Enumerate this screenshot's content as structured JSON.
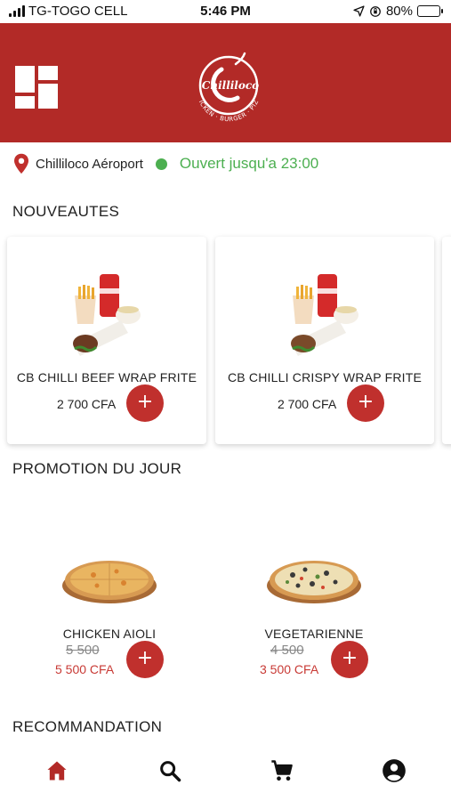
{
  "status_bar": {
    "carrier": "TG-TOGO CELL",
    "time": "5:46 PM",
    "battery_text": "80%",
    "battery_level": 0.8
  },
  "header": {
    "menu_icon": "grid-menu-icon",
    "logo_text": "Chilliloco",
    "logo_tagline": "CHICKEN · BURGER · PIZZA",
    "background": "#b22a27"
  },
  "location": {
    "store": "Chilliloco Aéroport",
    "status": "Ouvert jusqu'a 23:00",
    "status_color": "#4caf50"
  },
  "sections": {
    "new": "NOUVEAUTES",
    "promo": "PROMOTION DU JOUR",
    "recommend": "RECOMMANDATION"
  },
  "new_items": [
    {
      "name": "CB CHILLI BEEF WRAP FRITE",
      "price": "2 700 CFA",
      "add": "+"
    },
    {
      "name": "CB CHILLI CRISPY WRAP FRITE",
      "price": "2 700 CFA",
      "add": "+"
    }
  ],
  "promo_items": [
    {
      "name": "CHICKEN AIOLI",
      "old_price": "5 500",
      "price": "5 500 CFA",
      "add": "+"
    },
    {
      "name": "VEGETARIENNE",
      "old_price": "4 500",
      "price": "3 500 CFA",
      "add": "+"
    }
  ],
  "nav": [
    {
      "icon": "home-icon",
      "active": true
    },
    {
      "icon": "search-icon",
      "active": false
    },
    {
      "icon": "cart-icon",
      "active": false
    },
    {
      "icon": "account-icon",
      "active": false
    }
  ],
  "accent": "#c0302d"
}
